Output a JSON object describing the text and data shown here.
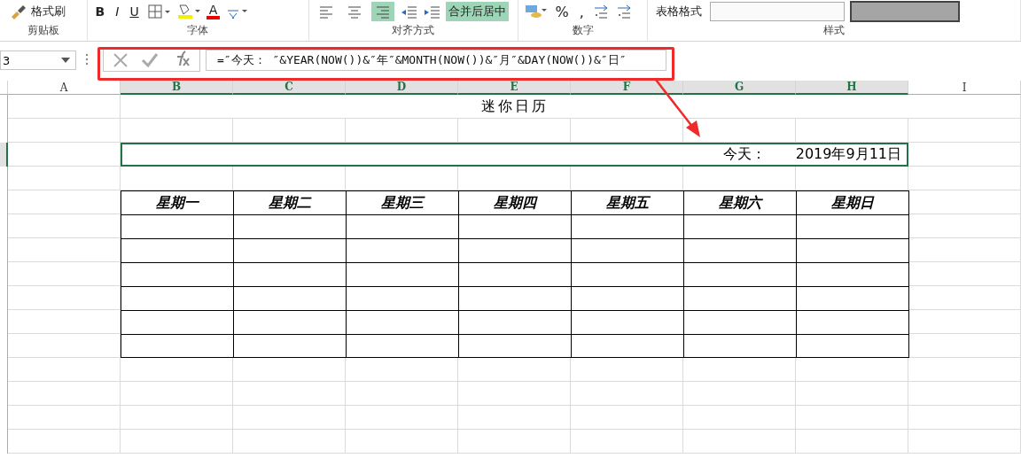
{
  "ribbon": {
    "groups": [
      {
        "label": "剪贴板",
        "buttons": [
          {
            "kind": "brush",
            "label": "格式刷"
          }
        ]
      },
      {
        "label": "字体",
        "buttons": [
          {
            "kind": "bold",
            "label": "B"
          },
          {
            "kind": "italic",
            "label": "I"
          },
          {
            "kind": "underline",
            "label": "U"
          },
          {
            "kind": "borders"
          },
          {
            "kind": "fill"
          },
          {
            "kind": "fontcolor",
            "label": "A"
          },
          {
            "kind": "phonetic"
          }
        ]
      },
      {
        "label": "对齐方式",
        "buttons": [
          {
            "kind": "align-left",
            "selected": false
          },
          {
            "kind": "align-center",
            "selected": false
          },
          {
            "kind": "align-right",
            "selected": true
          },
          {
            "kind": "outdent"
          },
          {
            "kind": "indent"
          },
          {
            "kind": "merge",
            "label": "合并后居中",
            "selected": true
          }
        ]
      },
      {
        "label": "数字",
        "buttons": [
          {
            "kind": "currency"
          },
          {
            "kind": "symbol",
            "label": "%"
          },
          {
            "kind": "symbol",
            "label": ","
          },
          {
            "kind": "decimals"
          },
          {
            "kind": "decimals"
          }
        ]
      },
      {
        "label": "样式",
        "buttons": [
          {
            "kind": "table-format",
            "label": "表格格式"
          },
          {
            "kind": "style-box"
          },
          {
            "kind": "style-box-dark"
          }
        ]
      }
    ]
  },
  "formula_bar": {
    "name_box": "3",
    "formula": "=″今天：   ″&YEAR(NOW())&″年″&MONTH(NOW())&″月″&DAY(NOW())&″日″"
  },
  "sheet": {
    "columns": [
      {
        "label": "A",
        "selected": false
      },
      {
        "label": "B",
        "selected": true
      },
      {
        "label": "C",
        "selected": true
      },
      {
        "label": "D",
        "selected": true
      },
      {
        "label": "E",
        "selected": true
      },
      {
        "label": "F",
        "selected": true
      },
      {
        "label": "G",
        "selected": true
      },
      {
        "label": "H",
        "selected": true
      },
      {
        "label": "I",
        "selected": false
      }
    ],
    "title": "迷你日历",
    "today": {
      "label": "今天：",
      "date": "2019年9月11日",
      "selected": true
    },
    "weekdays": [
      "星期一",
      "星期二",
      "星期三",
      "星期四",
      "星期五",
      "星期六",
      "星期日"
    ]
  }
}
